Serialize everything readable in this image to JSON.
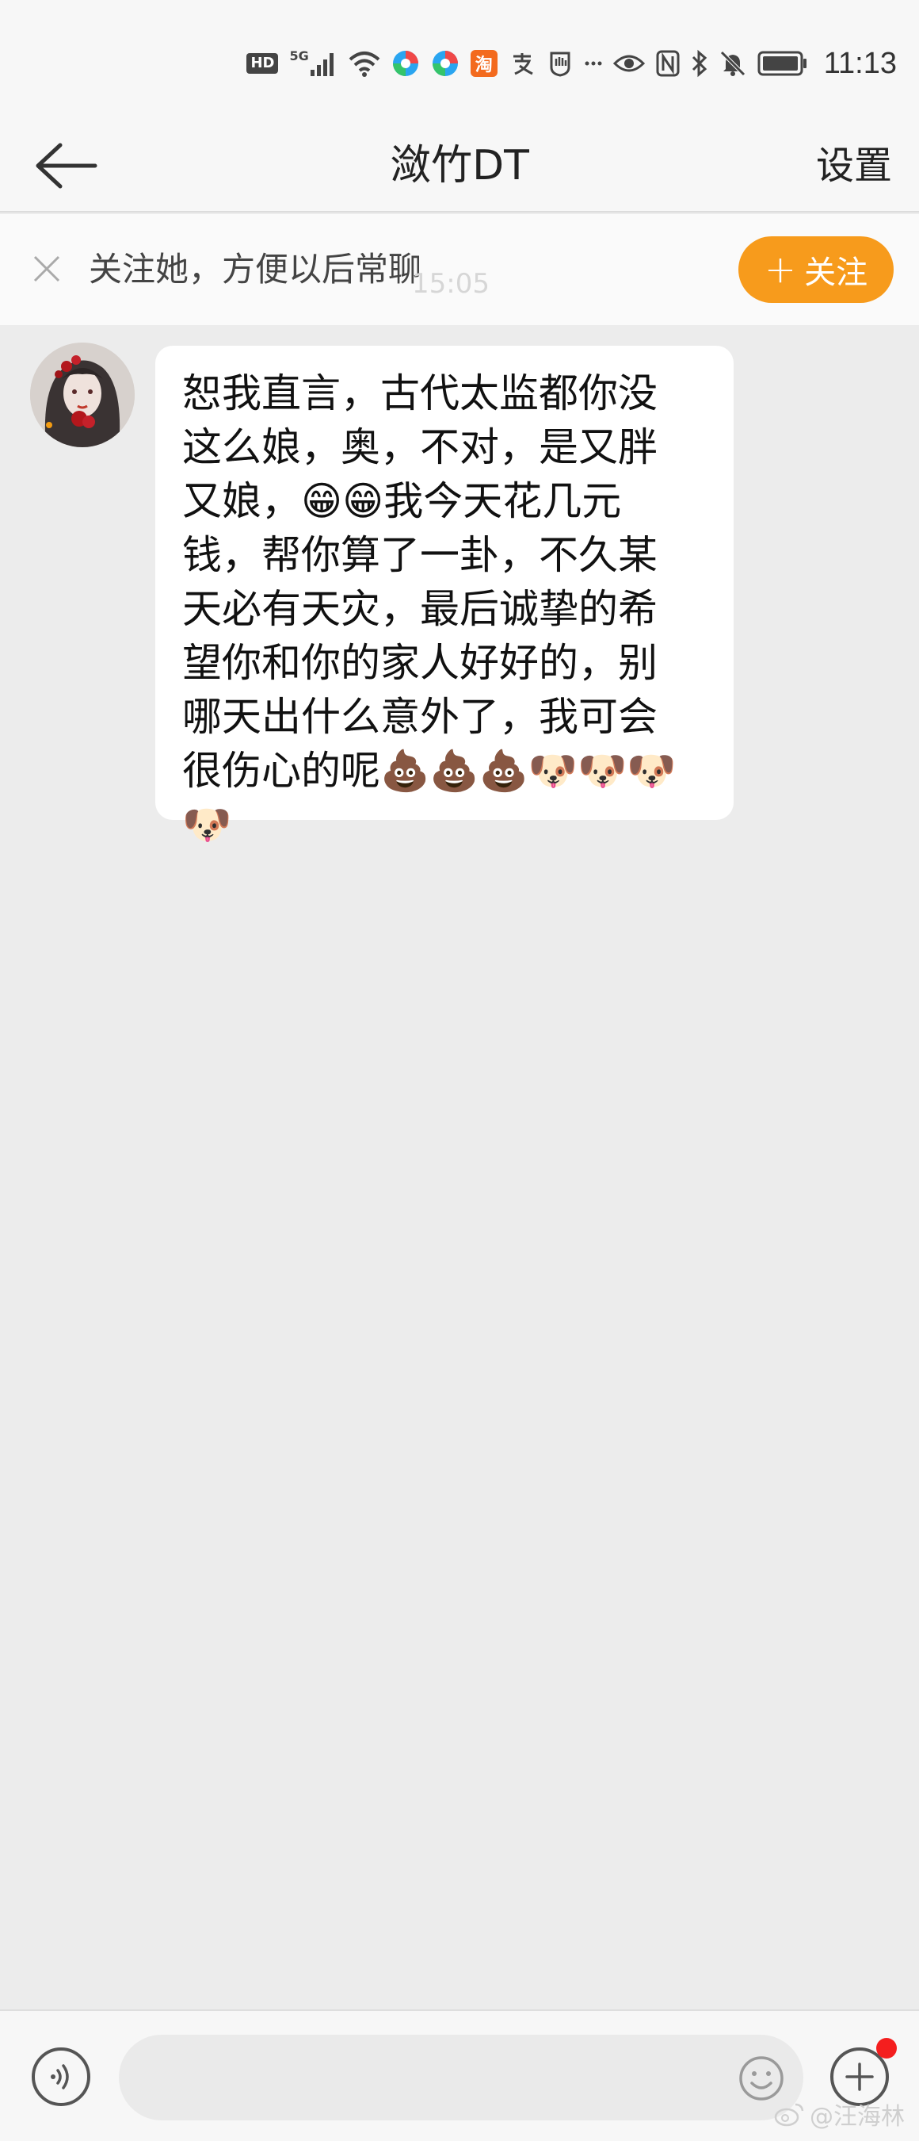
{
  "status_bar": {
    "hd": "HD",
    "network": "5G",
    "app_badge": "淘",
    "time": "11:13"
  },
  "header": {
    "title": "潋竹DT",
    "settings_label": "设置"
  },
  "follow_bar": {
    "prompt": "关注她，方便以后常聊",
    "faded_time": "15:05",
    "follow_label": "关注"
  },
  "message": {
    "text": "恕我直言，古代太监都你没这么娘，奥，不对，是又胖又娘，😁😁我今天花几元钱，帮你算了一卦，不久某天必有天灾，最后诚挚的希望你和你的家人好好的，别哪天出什么意外了，我可会很伤心的呢💩💩💩🐶🐶🐶🐶"
  },
  "input_bar": {
    "placeholder": ""
  },
  "watermark": {
    "text": "@汪海林"
  },
  "colors": {
    "accent": "#f79b1c",
    "background": "#ececec",
    "bubble": "#ffffff",
    "badge": "#f41e1e"
  }
}
